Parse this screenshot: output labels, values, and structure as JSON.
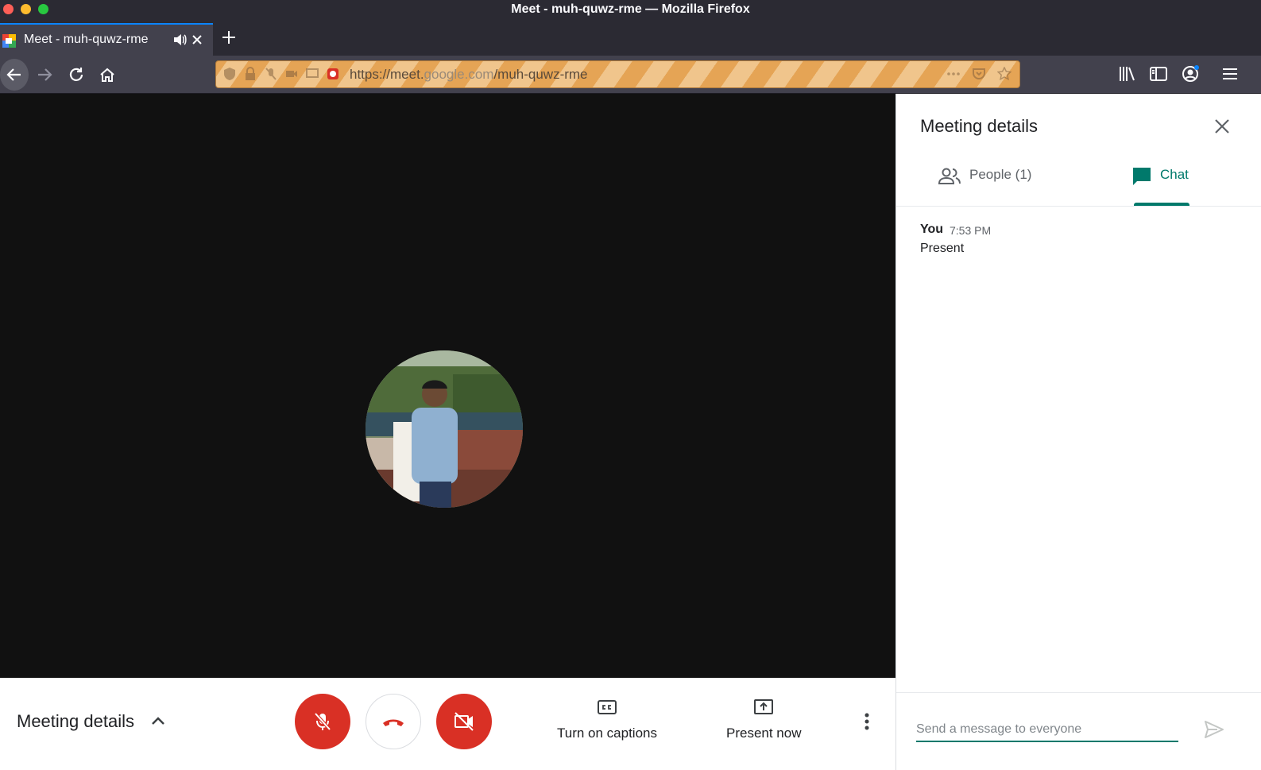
{
  "window": {
    "title": "Meet - muh-quwz-rme — Mozilla Firefox"
  },
  "tab": {
    "title": "Meet - muh-quwz-rme"
  },
  "address_bar": {
    "prefix": "https://meet.",
    "host_dim": "google.com",
    "path": "/muh-quwz-rme"
  },
  "meeting": {
    "details_label": "Meeting details",
    "captions_label": "Turn on captions",
    "present_label": "Present now"
  },
  "panel": {
    "title": "Meeting details",
    "tabs": [
      {
        "label": "People (1)",
        "selected": false
      },
      {
        "label": "Chat",
        "selected": true
      }
    ],
    "messages": [
      {
        "sender": "You",
        "time": "7:53 PM",
        "text": "Present"
      }
    ],
    "compose_placeholder": "Send a message to everyone"
  },
  "colors": {
    "accent": "#00796b",
    "danger": "#d93025",
    "stage": "#111111"
  }
}
